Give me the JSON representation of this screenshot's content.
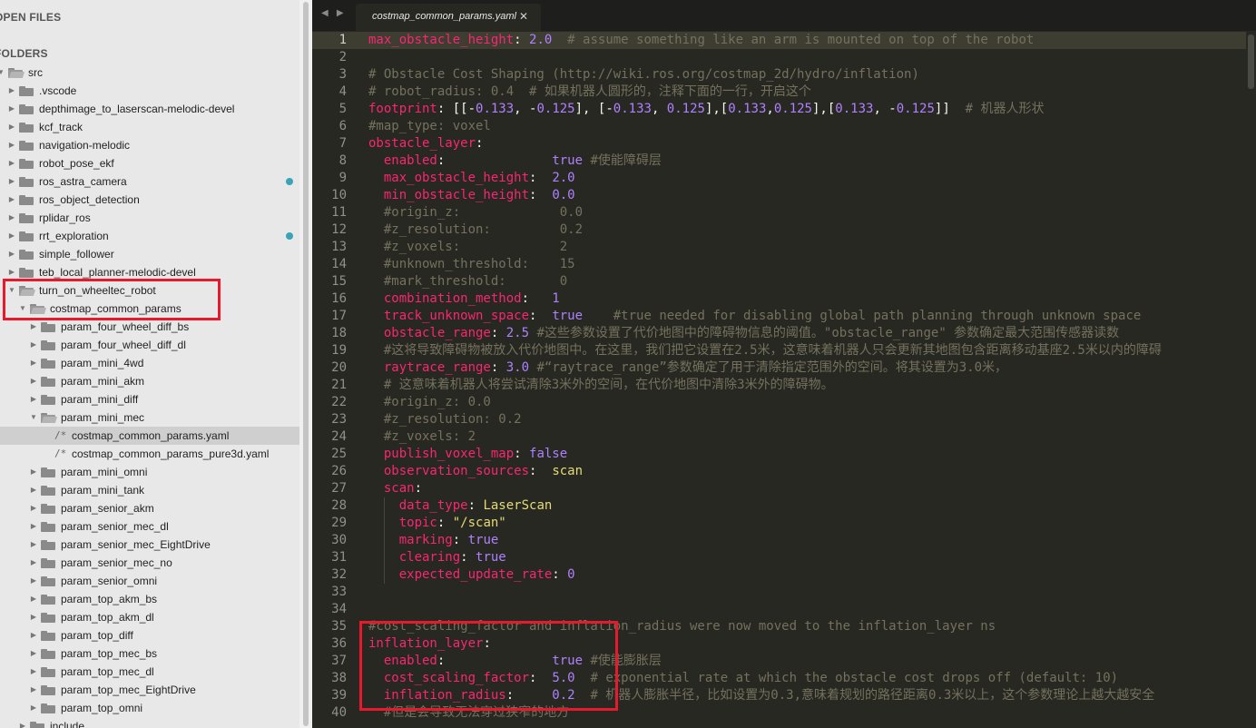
{
  "sidebar": {
    "open_files_header": "OPEN FILES",
    "folders_header": "FOLDERS",
    "tree": [
      {
        "label": "src",
        "level": 0,
        "kind": "folder",
        "open": true
      },
      {
        "label": ".vscode",
        "level": 1,
        "kind": "folder",
        "open": false
      },
      {
        "label": "depthimage_to_laserscan-melodic-devel",
        "level": 1,
        "kind": "folder",
        "open": false
      },
      {
        "label": "kcf_track",
        "level": 1,
        "kind": "folder",
        "open": false
      },
      {
        "label": "navigation-melodic",
        "level": 1,
        "kind": "folder",
        "open": false
      },
      {
        "label": "robot_pose_ekf",
        "level": 1,
        "kind": "folder",
        "open": false
      },
      {
        "label": "ros_astra_camera",
        "level": 1,
        "kind": "folder",
        "open": false,
        "modified": true
      },
      {
        "label": "ros_object_detection",
        "level": 1,
        "kind": "folder",
        "open": false
      },
      {
        "label": "rplidar_ros",
        "level": 1,
        "kind": "folder",
        "open": false
      },
      {
        "label": "rrt_exploration",
        "level": 1,
        "kind": "folder",
        "open": false,
        "modified": true
      },
      {
        "label": "simple_follower",
        "level": 1,
        "kind": "folder",
        "open": false
      },
      {
        "label": "teb_local_planner-melodic-devel",
        "level": 1,
        "kind": "folder",
        "open": false
      },
      {
        "label": "turn_on_wheeltec_robot",
        "level": 1,
        "kind": "folder",
        "open": true
      },
      {
        "label": "costmap_common_params",
        "level": 2,
        "kind": "folder",
        "open": true
      },
      {
        "label": "param_four_wheel_diff_bs",
        "level": 3,
        "kind": "folder",
        "open": false
      },
      {
        "label": "param_four_wheel_diff_dl",
        "level": 3,
        "kind": "folder",
        "open": false
      },
      {
        "label": "param_mini_4wd",
        "level": 3,
        "kind": "folder",
        "open": false
      },
      {
        "label": "param_mini_akm",
        "level": 3,
        "kind": "folder",
        "open": false
      },
      {
        "label": "param_mini_diff",
        "level": 3,
        "kind": "folder",
        "open": false
      },
      {
        "label": "param_mini_mec",
        "level": 3,
        "kind": "folder",
        "open": true
      },
      {
        "label": "costmap_common_params.yaml",
        "level": 4,
        "kind": "file",
        "selected": true
      },
      {
        "label": "costmap_common_params_pure3d.yaml",
        "level": 4,
        "kind": "file"
      },
      {
        "label": "param_mini_omni",
        "level": 3,
        "kind": "folder",
        "open": false
      },
      {
        "label": "param_mini_tank",
        "level": 3,
        "kind": "folder",
        "open": false
      },
      {
        "label": "param_senior_akm",
        "level": 3,
        "kind": "folder",
        "open": false
      },
      {
        "label": "param_senior_mec_dl",
        "level": 3,
        "kind": "folder",
        "open": false
      },
      {
        "label": "param_senior_mec_EightDrive",
        "level": 3,
        "kind": "folder",
        "open": false
      },
      {
        "label": "param_senior_mec_no",
        "level": 3,
        "kind": "folder",
        "open": false
      },
      {
        "label": "param_senior_omni",
        "level": 3,
        "kind": "folder",
        "open": false
      },
      {
        "label": "param_top_akm_bs",
        "level": 3,
        "kind": "folder",
        "open": false
      },
      {
        "label": "param_top_akm_dl",
        "level": 3,
        "kind": "folder",
        "open": false
      },
      {
        "label": "param_top_diff",
        "level": 3,
        "kind": "folder",
        "open": false
      },
      {
        "label": "param_top_mec_bs",
        "level": 3,
        "kind": "folder",
        "open": false
      },
      {
        "label": "param_top_mec_dl",
        "level": 3,
        "kind": "folder",
        "open": false
      },
      {
        "label": "param_top_mec_EightDrive",
        "level": 3,
        "kind": "folder",
        "open": false
      },
      {
        "label": "param_top_omni",
        "level": 3,
        "kind": "folder",
        "open": false
      },
      {
        "label": "include",
        "level": 2,
        "kind": "folder",
        "open": false
      }
    ]
  },
  "tabbar": {
    "nav_label": "◀ ▶",
    "active_tab": "costmap_common_params.yaml",
    "close_glyph": "✕"
  },
  "editor": {
    "current_line": 1,
    "lines": [
      [
        [
          "k",
          "max_obstacle_height"
        ],
        [
          "p",
          ": "
        ],
        [
          "n",
          "2.0"
        ],
        [
          "c",
          "  # assume something like an arm is mounted on top of the robot"
        ]
      ],
      [],
      [
        [
          "c",
          "# Obstacle Cost Shaping (http://wiki.ros.org/costmap_2d/hydro/inflation)"
        ]
      ],
      [
        [
          "c",
          "# robot_radius: 0.4  # 如果机器人圆形的，注释下面的一行，开启这个"
        ]
      ],
      [
        [
          "k",
          "footprint"
        ],
        [
          "p",
          ": [[-"
        ],
        [
          "n",
          "0.133"
        ],
        [
          "p",
          ", -"
        ],
        [
          "n",
          "0.125"
        ],
        [
          "p",
          "], [-"
        ],
        [
          "n",
          "0.133"
        ],
        [
          "p",
          ", "
        ],
        [
          "n",
          "0.125"
        ],
        [
          "p",
          "],["
        ],
        [
          "n",
          "0.133"
        ],
        [
          "p",
          ","
        ],
        [
          "n",
          "0.125"
        ],
        [
          "p",
          "],["
        ],
        [
          "n",
          "0.133"
        ],
        [
          "p",
          ", -"
        ],
        [
          "n",
          "0.125"
        ],
        [
          "p",
          "]]"
        ],
        [
          "c",
          "  # 机器人形状"
        ]
      ],
      [
        [
          "c",
          "#map_type: voxel"
        ]
      ],
      [
        [
          "k",
          "obstacle_layer"
        ],
        [
          "p",
          ":"
        ]
      ],
      [
        [
          "w",
          "  "
        ],
        [
          "k",
          "enabled"
        ],
        [
          "p",
          ":              "
        ],
        [
          "n",
          "true"
        ],
        [
          "c",
          " #使能障碍层"
        ]
      ],
      [
        [
          "w",
          "  "
        ],
        [
          "k",
          "max_obstacle_height"
        ],
        [
          "p",
          ":  "
        ],
        [
          "n",
          "2.0"
        ]
      ],
      [
        [
          "w",
          "  "
        ],
        [
          "k",
          "min_obstacle_height"
        ],
        [
          "p",
          ":  "
        ],
        [
          "n",
          "0.0"
        ]
      ],
      [
        [
          "w",
          "  "
        ],
        [
          "c",
          "#origin_z:             0.0"
        ]
      ],
      [
        [
          "w",
          "  "
        ],
        [
          "c",
          "#z_resolution:         0.2"
        ]
      ],
      [
        [
          "w",
          "  "
        ],
        [
          "c",
          "#z_voxels:             2"
        ]
      ],
      [
        [
          "w",
          "  "
        ],
        [
          "c",
          "#unknown_threshold:    15"
        ]
      ],
      [
        [
          "w",
          "  "
        ],
        [
          "c",
          "#mark_threshold:       0"
        ]
      ],
      [
        [
          "w",
          "  "
        ],
        [
          "k",
          "combination_method"
        ],
        [
          "p",
          ":   "
        ],
        [
          "n",
          "1"
        ]
      ],
      [
        [
          "w",
          "  "
        ],
        [
          "k",
          "track_unknown_space"
        ],
        [
          "p",
          ":  "
        ],
        [
          "n",
          "true"
        ],
        [
          "c",
          "    #true needed for disabling global path planning through unknown space"
        ]
      ],
      [
        [
          "w",
          "  "
        ],
        [
          "k",
          "obstacle_range"
        ],
        [
          "p",
          ": "
        ],
        [
          "n",
          "2.5"
        ],
        [
          "c",
          " #这些参数设置了代价地图中的障碍物信息的阈值。\"obstacle_range\" 参数确定最大范围传感器读数"
        ]
      ],
      [
        [
          "w",
          "  "
        ],
        [
          "c",
          "#这将导致障碍物被放入代价地图中。在这里，我们把它设置在2.5米，这意味着机器人只会更新其地图包含距离移动基座2.5米以内的障碍"
        ]
      ],
      [
        [
          "w",
          "  "
        ],
        [
          "k",
          "raytrace_range"
        ],
        [
          "p",
          ": "
        ],
        [
          "n",
          "3.0"
        ],
        [
          "c",
          " #“raytrace_range”参数确定了用于清除指定范围外的空间。将其设置为3.0米，"
        ]
      ],
      [
        [
          "w",
          "  "
        ],
        [
          "c",
          "# 这意味着机器人将尝试清除3米外的空间，在代价地图中清除3米外的障碍物。"
        ]
      ],
      [
        [
          "w",
          "  "
        ],
        [
          "c",
          "#origin_z: 0.0"
        ]
      ],
      [
        [
          "w",
          "  "
        ],
        [
          "c",
          "#z_resolution: 0.2"
        ]
      ],
      [
        [
          "w",
          "  "
        ],
        [
          "c",
          "#z_voxels: 2"
        ]
      ],
      [
        [
          "w",
          "  "
        ],
        [
          "k",
          "publish_voxel_map"
        ],
        [
          "p",
          ": "
        ],
        [
          "n",
          "false"
        ]
      ],
      [
        [
          "w",
          "  "
        ],
        [
          "k",
          "observation_sources"
        ],
        [
          "p",
          ":  "
        ],
        [
          "s",
          "scan"
        ]
      ],
      [
        [
          "w",
          "  "
        ],
        [
          "k",
          "scan"
        ],
        [
          "p",
          ":"
        ]
      ],
      [
        [
          "w",
          "    "
        ],
        [
          "k",
          "data_type"
        ],
        [
          "p",
          ": "
        ],
        [
          "s",
          "LaserScan"
        ]
      ],
      [
        [
          "w",
          "    "
        ],
        [
          "k",
          "topic"
        ],
        [
          "p",
          ": "
        ],
        [
          "s",
          "\"/scan\""
        ]
      ],
      [
        [
          "w",
          "    "
        ],
        [
          "k",
          "marking"
        ],
        [
          "p",
          ": "
        ],
        [
          "n",
          "true"
        ]
      ],
      [
        [
          "w",
          "    "
        ],
        [
          "k",
          "clearing"
        ],
        [
          "p",
          ": "
        ],
        [
          "n",
          "true"
        ]
      ],
      [
        [
          "w",
          "    "
        ],
        [
          "k",
          "expected_update_rate"
        ],
        [
          "p",
          ": "
        ],
        [
          "n",
          "0"
        ]
      ],
      [],
      [],
      [
        [
          "c",
          "#cost_scaling_factor and inflation_radius were now moved to the inflation_layer ns"
        ]
      ],
      [
        [
          "k",
          "inflation_layer"
        ],
        [
          "p",
          ":"
        ]
      ],
      [
        [
          "w",
          "  "
        ],
        [
          "k",
          "enabled"
        ],
        [
          "p",
          ":              "
        ],
        [
          "n",
          "true"
        ],
        [
          "c",
          " #使能膨胀层"
        ]
      ],
      [
        [
          "w",
          "  "
        ],
        [
          "k",
          "cost_scaling_factor"
        ],
        [
          "p",
          ":  "
        ],
        [
          "n",
          "5.0"
        ],
        [
          "c",
          "  # exponential rate at which the obstacle cost drops off (default: 10)"
        ]
      ],
      [
        [
          "w",
          "  "
        ],
        [
          "k",
          "inflation_radius"
        ],
        [
          "p",
          ":     "
        ],
        [
          "n",
          "0.2"
        ],
        [
          "c",
          "  # 机器人膨胀半径，比如设置为0.3,意味着规划的路径距离0.3米以上，这个参数理论上越大越安全"
        ]
      ],
      [
        [
          "w",
          "  "
        ],
        [
          "c",
          "#但是会导致无法穿过狭窄的地方"
        ]
      ]
    ]
  }
}
